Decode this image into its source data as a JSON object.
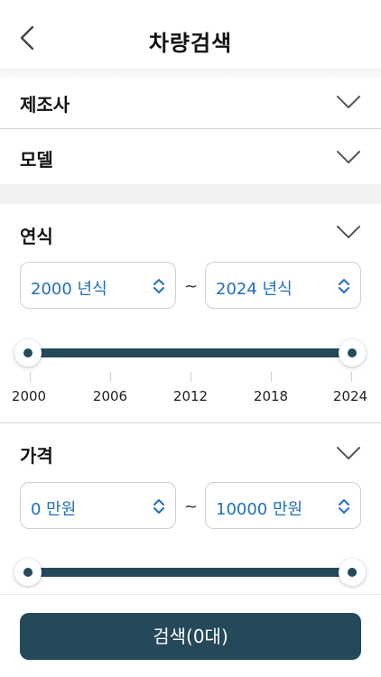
{
  "header": {
    "title": "차량검색"
  },
  "filters": {
    "manufacturer": {
      "label": "제조사"
    },
    "model": {
      "label": "모델"
    },
    "year": {
      "label": "연식",
      "from": "2000 년식",
      "to": "2024 년식",
      "separator": "~",
      "range_min": 2000,
      "range_max": 2024,
      "selected_min": 2000,
      "selected_max": 2024,
      "ticks": [
        "2000",
        "2006",
        "2012",
        "2018",
        "2024"
      ]
    },
    "price": {
      "label": "가격",
      "from": "0 만원",
      "to": "10000 만원",
      "separator": "~",
      "range_min": 0,
      "range_max": 10000,
      "selected_min": 0,
      "selected_max": 10000
    }
  },
  "search_button": {
    "label": "검색(0대)"
  },
  "colors": {
    "accent": "#24495a",
    "value_text": "#1f6fc0"
  }
}
